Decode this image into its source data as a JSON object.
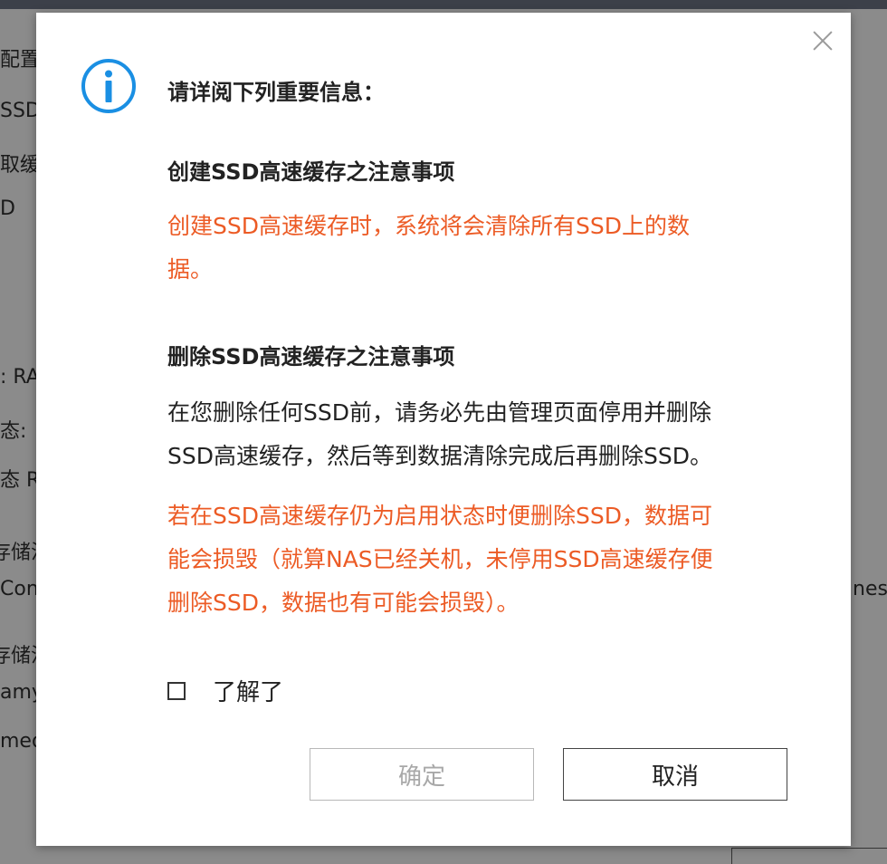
{
  "background": {
    "texts": [
      {
        "id": "bg-1",
        "text": "配置"
      },
      {
        "id": "bg-2",
        "text": "SSD"
      },
      {
        "id": "bg-3",
        "text": "取缓"
      },
      {
        "id": "bg-4",
        "text": "D"
      },
      {
        "id": "bg-5",
        "text": ": RA"
      },
      {
        "id": "bg-6",
        "text": "态:"
      },
      {
        "id": "bg-7",
        "text": "态 R"
      },
      {
        "id": "bg-8",
        "text": "存储池"
      },
      {
        "id": "bg-9",
        "text": "Con"
      },
      {
        "id": "bg-10",
        "text": "存储池"
      },
      {
        "id": "bg-11",
        "text": "amy"
      },
      {
        "id": "bg-12",
        "text": "med"
      },
      {
        "id": "bg-13",
        "text": "nes"
      }
    ]
  },
  "dialog": {
    "headline": "请详阅下列重要信息：",
    "section1": {
      "title": "创建SSD高速缓存之注意事项",
      "warning_lines": [
        "创建SSD高速缓存时，系统将会清除所有SSD上的数",
        "据。"
      ]
    },
    "section2": {
      "title": "删除SSD高速缓存之注意事项",
      "info_lines": [
        "在您删除任何SSD前，请务必先由管理页面停用并删除",
        "SSD高速缓存，然后等到数据清除完成后再删除SSD。"
      ],
      "warning_lines": [
        "若在SSD高速缓存仍为启用状态时便删除SSD，数据可",
        "能会损毁（就算NAS已经关机，未停用SSD高速缓存便",
        "删除SSD，数据也有可能会损毁）。"
      ]
    },
    "checkbox": {
      "label": "了解了",
      "checked": false
    },
    "buttons": {
      "ok_label": "确定",
      "ok_enabled": false,
      "cancel_label": "取消"
    },
    "icons": {
      "info": "info-icon",
      "close": "close-icon"
    },
    "colors": {
      "warning": "#ec5b25",
      "info_icon": "#1a8fe3"
    }
  }
}
